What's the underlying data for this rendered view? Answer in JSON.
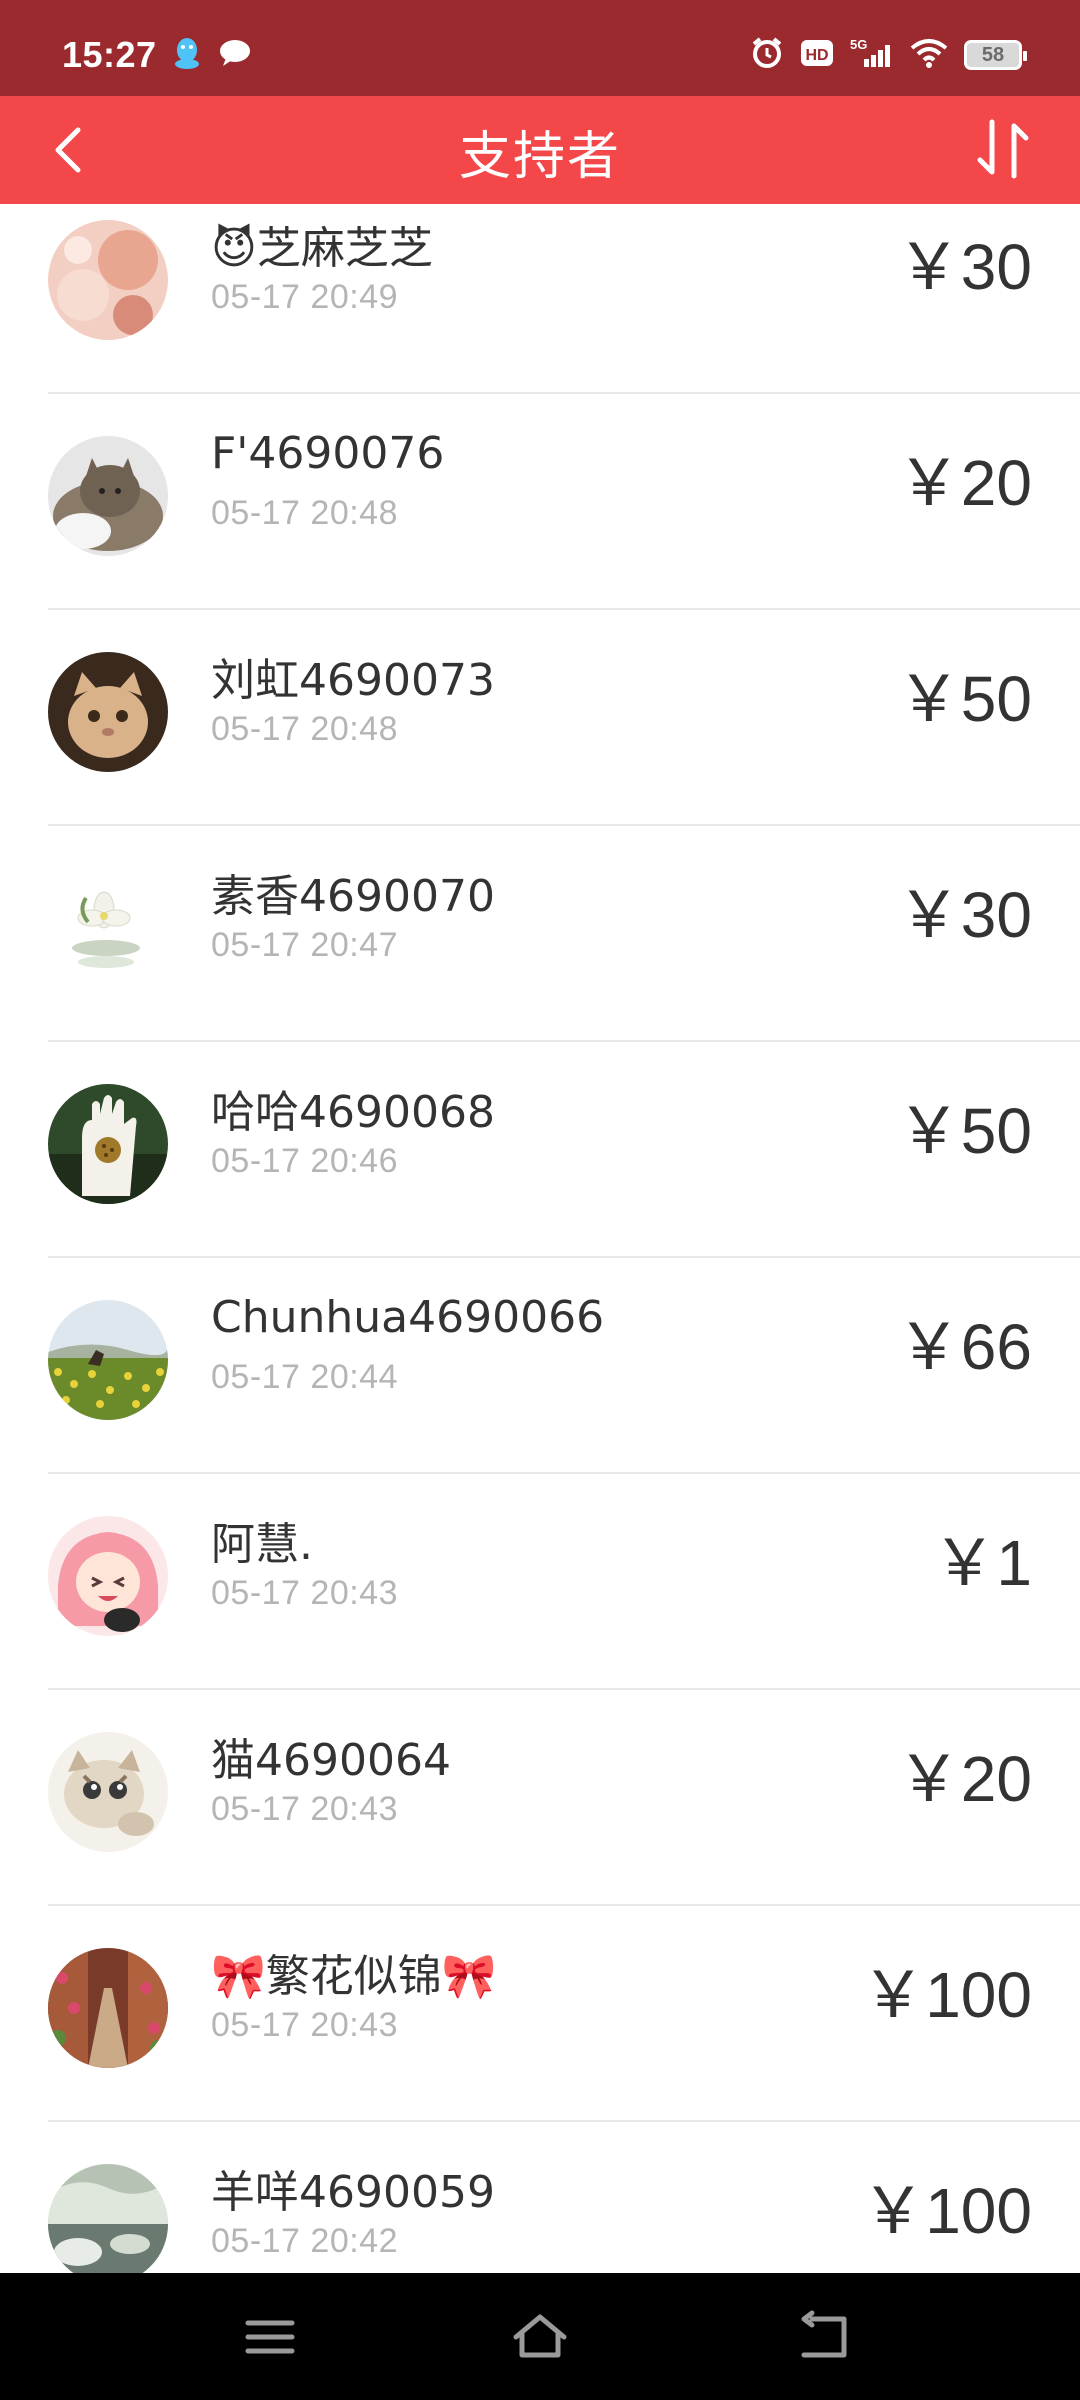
{
  "status_bar": {
    "time": "15:27",
    "battery": "58",
    "left_icons": [
      "qq-icon",
      "message-icon"
    ],
    "right_icons": [
      "alarm-icon",
      "hd-icon",
      "signal-5g-icon",
      "wifi-icon",
      "battery-icon"
    ]
  },
  "header": {
    "title": "支持者",
    "back_icon": "chevron-left-icon",
    "sort_icon": "sort-icon"
  },
  "supporters": [
    {
      "name": "😈芝麻芝芝",
      "time": "05-17 20:49",
      "amount": "￥30"
    },
    {
      "name": "F'4690076",
      "time": "05-17 20:48",
      "amount": "￥20"
    },
    {
      "name": "刘虹4690073",
      "time": "05-17 20:48",
      "amount": "￥50"
    },
    {
      "name": "素香4690070",
      "time": "05-17 20:47",
      "amount": "￥30"
    },
    {
      "name": "哈哈4690068",
      "time": "05-17 20:46",
      "amount": "￥50"
    },
    {
      "name": "Chunhua4690066",
      "time": "05-17 20:44",
      "amount": "￥66"
    },
    {
      "name": "阿慧.",
      "time": "05-17 20:43",
      "amount": "￥1"
    },
    {
      "name": "猫4690064",
      "time": "05-17 20:43",
      "amount": "￥20"
    },
    {
      "name": "🎀繁花似锦🎀",
      "time": "05-17 20:43",
      "amount": "￥100"
    },
    {
      "name": "羊咩4690059",
      "time": "05-17 20:42",
      "amount": "￥100"
    }
  ],
  "nav_bar": {
    "icons": [
      "menu-icon",
      "home-icon",
      "back-icon"
    ]
  },
  "colors": {
    "status_bar": "#9b2a2e",
    "header": "#f3474a",
    "text_primary": "#333333",
    "text_secondary": "#b5b5b5"
  }
}
